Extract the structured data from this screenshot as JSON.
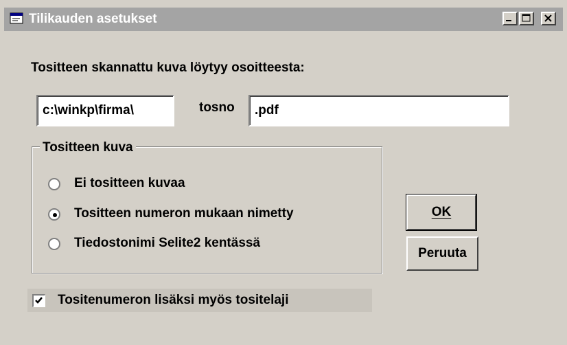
{
  "window": {
    "title": "Tilikauden asetukset",
    "controls": {
      "minimize": "_",
      "maximize": "□",
      "close": "×"
    }
  },
  "form": {
    "path_label": "Tositteen skannattu kuva löytyy osoitteesta:",
    "path_value": "c:\\winkp\\firma\\",
    "middle_label": "tosno",
    "ext_value": ".pdf"
  },
  "group": {
    "title": "Tositteen kuva",
    "options": [
      {
        "label": "Ei tositteen kuvaa",
        "checked": false
      },
      {
        "label": "Tositteen numeron mukaan nimetty",
        "checked": true
      },
      {
        "label": "Tiedostonimi Selite2 kentässä",
        "checked": false
      }
    ]
  },
  "buttons": {
    "ok_label": "OK",
    "cancel_label": "Peruuta"
  },
  "checkbox": {
    "label": "Tositenumeron lisäksi myös tositelaji",
    "checked": true
  },
  "colors": {
    "face": "#d4d0c8",
    "titlebar_inactive": "#a4a4a4"
  }
}
